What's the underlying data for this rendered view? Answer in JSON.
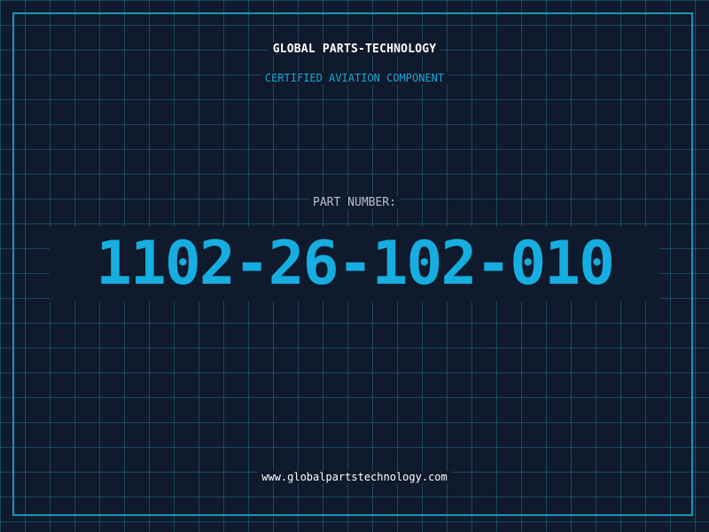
{
  "header": {
    "company": "GLOBAL PARTS-TECHNOLOGY",
    "tagline": "CERTIFIED AVIATION COMPONENT"
  },
  "part": {
    "label": "PART NUMBER:",
    "number": "1102-26-102-010"
  },
  "footer": {
    "website": "www.globalpartstechnology.com"
  },
  "colors": {
    "background": "#0f1a2c",
    "grid": "#236e8c",
    "frame": "#1597b8",
    "accent": "#16aee0",
    "label": "#b8c0cc",
    "text": "#ffffff"
  }
}
